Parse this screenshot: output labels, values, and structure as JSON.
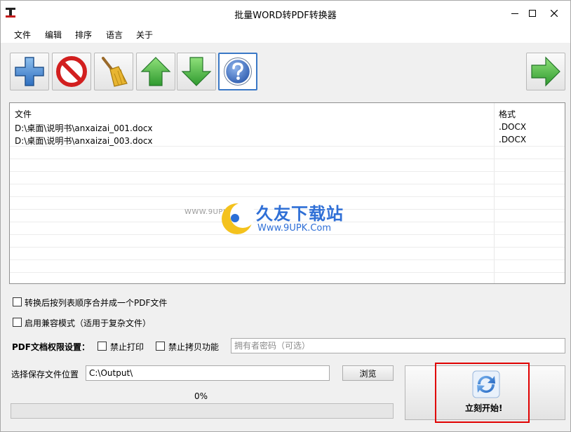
{
  "window": {
    "title": "批量WORD转PDF转换器"
  },
  "menu": {
    "items": [
      "文件",
      "编辑",
      "排序",
      "语言",
      "关于"
    ]
  },
  "toolbar": {
    "buttons": [
      {
        "name": "add",
        "icon": "plus-icon"
      },
      {
        "name": "remove",
        "icon": "no-sign-icon"
      },
      {
        "name": "clear",
        "icon": "broom-icon"
      },
      {
        "name": "move-up",
        "icon": "arrow-up-icon"
      },
      {
        "name": "move-down",
        "icon": "arrow-down-icon"
      },
      {
        "name": "help",
        "icon": "question-icon"
      },
      {
        "name": "next",
        "icon": "arrow-right-icon"
      }
    ]
  },
  "file_list": {
    "columns": [
      "文件",
      "格式"
    ],
    "rows": [
      {
        "file": "D:\\桌面\\说明书\\anxaizai_001.docx",
        "format": ".DOCX"
      },
      {
        "file": "D:\\桌面\\说明书\\anxaizai_003.docx",
        "format": ".DOCX"
      }
    ]
  },
  "watermark": {
    "left_text": "WWW.9UPK.COM",
    "brand": "久友下载站",
    "url": "Www.9UPK.Com"
  },
  "options": {
    "merge_label": "转换后按列表顺序合并成一个PDF文件",
    "compat_label": "启用兼容模式（适用于复杂文件）",
    "permissions_label": "PDF文档权限设置：",
    "no_print_label": "禁止打印",
    "no_copy_label": "禁止拷贝功能",
    "owner_password_placeholder": "拥有者密码（可选）"
  },
  "output": {
    "label": "选择保存文件位置",
    "path": "C:\\Output\\",
    "browse_label": "浏览"
  },
  "progress": {
    "text": "0%",
    "value": 0
  },
  "start": {
    "label": "立刻开始!"
  },
  "colors": {
    "accent_green": "#3da83d",
    "help_blue": "#3a6fc4",
    "highlight_red": "#e00000"
  }
}
